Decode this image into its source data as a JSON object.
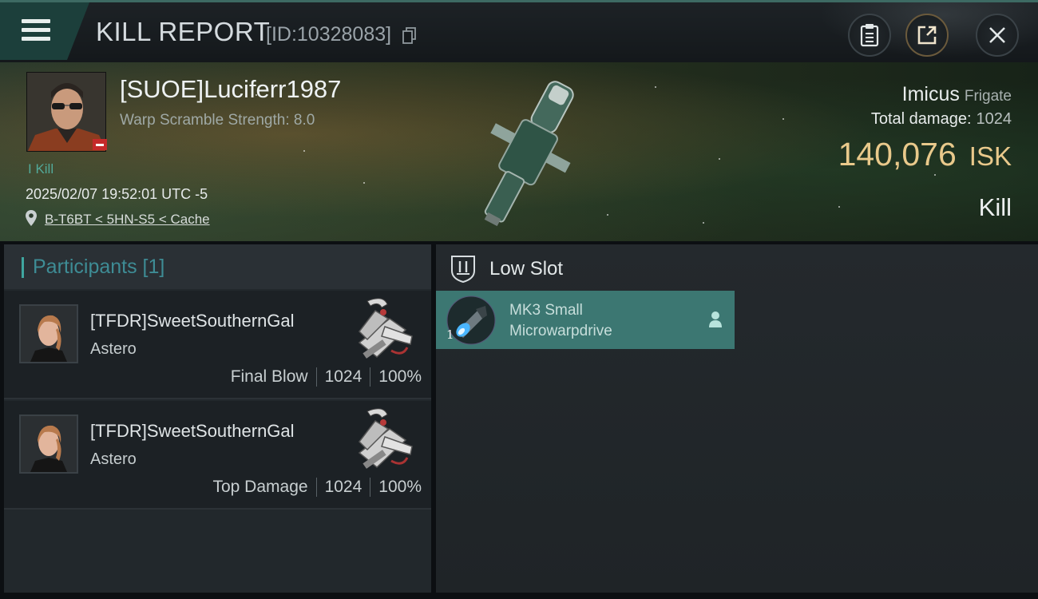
{
  "header": {
    "title": "KILL REPORT",
    "report_id": "[ID:10328083]"
  },
  "victim": {
    "name": "[SUOE]Luciferr1987",
    "warp_scramble": "Warp Scramble Strength: 8.0",
    "kill_tag": "I Kill",
    "timestamp": "2025/02/07 19:52:01 UTC -5",
    "location": "B-T6BT < 5HN-S5 < Cache",
    "ship_name": "Imicus",
    "ship_class": "Frigate",
    "total_damage_label": "Total damage:",
    "total_damage": "1024",
    "isk_value": "140,076",
    "isk_unit": "ISK",
    "report_type": "Kill"
  },
  "participants": {
    "title": "Participants [1]",
    "rows": [
      {
        "name": "[TFDR]SweetSouthernGal",
        "ship": "Astero",
        "tag": "Final Blow",
        "damage": "1024",
        "percent": "100%"
      },
      {
        "name": "[TFDR]SweetSouthernGal",
        "ship": "Astero",
        "tag": "Top Damage",
        "damage": "1024",
        "percent": "100%"
      }
    ]
  },
  "slots": {
    "title": "Low Slot",
    "modules": [
      {
        "line1": "MK3 Small",
        "line2": "Microwarpdrive",
        "qty": "1"
      }
    ]
  },
  "colors": {
    "accent_teal": "#3c7772",
    "isk_gold": "#e9c98b",
    "kill_green": "#52a999"
  }
}
